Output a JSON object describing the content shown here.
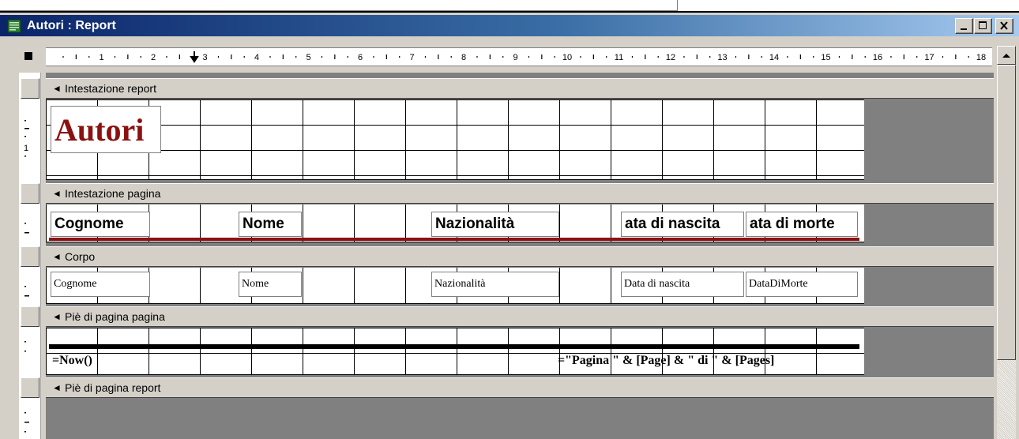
{
  "window": {
    "title": "Autori : Report",
    "controls": {
      "minimize": "minimize",
      "maximize": "maximize",
      "close": "close"
    }
  },
  "ruler": {
    "marks": [
      "1",
      "2",
      "3",
      "4",
      "5",
      "6",
      "7",
      "8",
      "9",
      "10",
      "11",
      "12",
      "13",
      "14",
      "15",
      "16",
      "17",
      "18"
    ]
  },
  "vertical_ruler": {
    "marks": [
      "1"
    ]
  },
  "sections": {
    "report_header": {
      "label": "Intestazione report",
      "title": "Autori",
      "title_color": "#8b1111"
    },
    "page_header": {
      "label": "Intestazione pagina",
      "columns": [
        "Cognome",
        "Nome",
        "Nazionalità",
        "ata di nascita",
        "ata di morte"
      ],
      "underline_color": "#8b1111"
    },
    "detail": {
      "label": "Corpo",
      "fields": [
        "Cognome",
        "Nome",
        "Nazionalità",
        "Data di nascita",
        "DataDiMorte"
      ]
    },
    "page_footer": {
      "label": "Piè di pagina pagina",
      "date_expr": "=Now()",
      "page_expr": "=\"Pagina \" & [Page] & \" di \" & [Pages]"
    },
    "report_footer": {
      "label": "Piè di pagina report"
    }
  },
  "icons": {
    "section_marker": "section-marker-icon",
    "window_app": "report-icon"
  },
  "colors": {
    "title_bar_start": "#0a246a",
    "title_bar_end": "#a6caf0",
    "surface_gray": "#808080",
    "accent_red": "#8b1111"
  }
}
